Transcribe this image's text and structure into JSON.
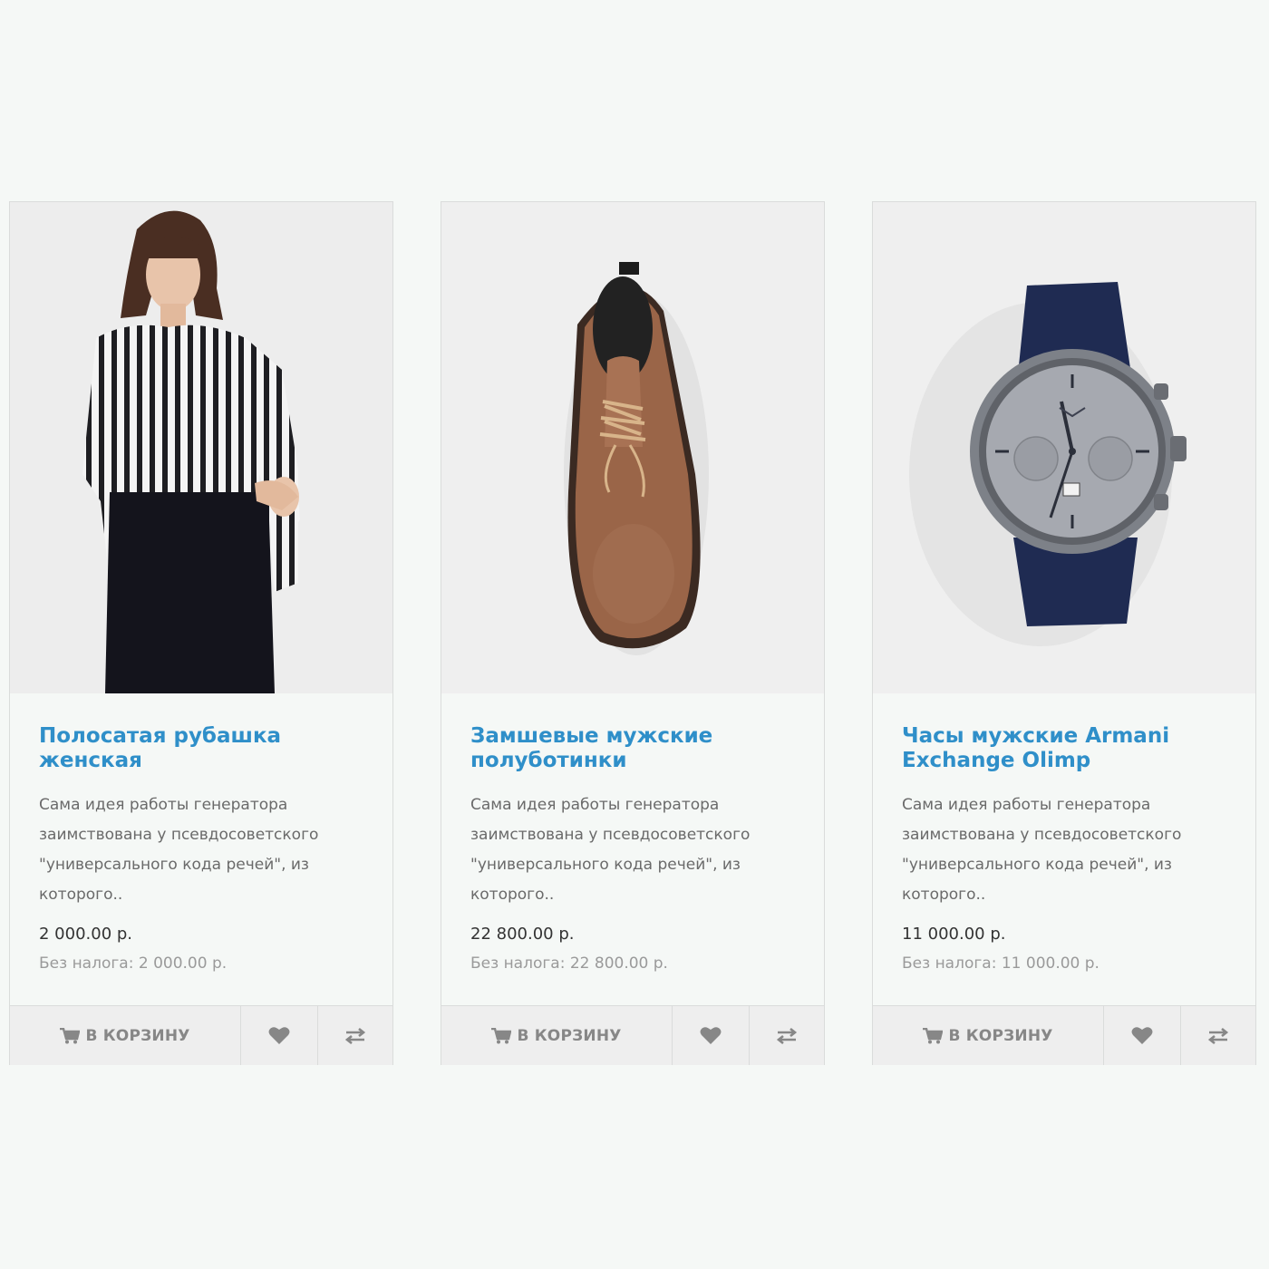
{
  "products": [
    {
      "title": "Полосатая рубашка женская",
      "description": "Сама идея работы генератора заимствована у псевдосоветского \"универсального кода речей\", из которого..",
      "price": "2 000.00 р.",
      "price_tax": "Без налога: 2 000.00 р.",
      "image": "striped-blouse-photo"
    },
    {
      "title": "Замшевые мужские полуботинки",
      "description": "Сама идея работы генератора заимствована у псевдосоветского \"универсального кода речей\", из которого..",
      "price": "22 800.00 р.",
      "price_tax": "Без налога: 22 800.00 р.",
      "image": "suede-boot-photo"
    },
    {
      "title": "Часы мужские Armani Exchange Olimp",
      "description": "Сама идея работы генератора заимствована у псевдосоветского \"универсального кода речей\", из которого..",
      "price": "11 000.00 р.",
      "price_tax": "Без налога: 11 000.00 р.",
      "image": "wrist-watch-photo"
    }
  ],
  "buttons": {
    "cart_label": "В КОРЗИНУ",
    "cart_icon": "shopping-cart-icon",
    "wishlist_icon": "heart-icon",
    "compare_icon": "exchange-arrows-icon"
  },
  "colors": {
    "background": "#f5f8f6",
    "title": "#2f8fc9",
    "button_text": "#878787",
    "border": "#dadcdb"
  }
}
